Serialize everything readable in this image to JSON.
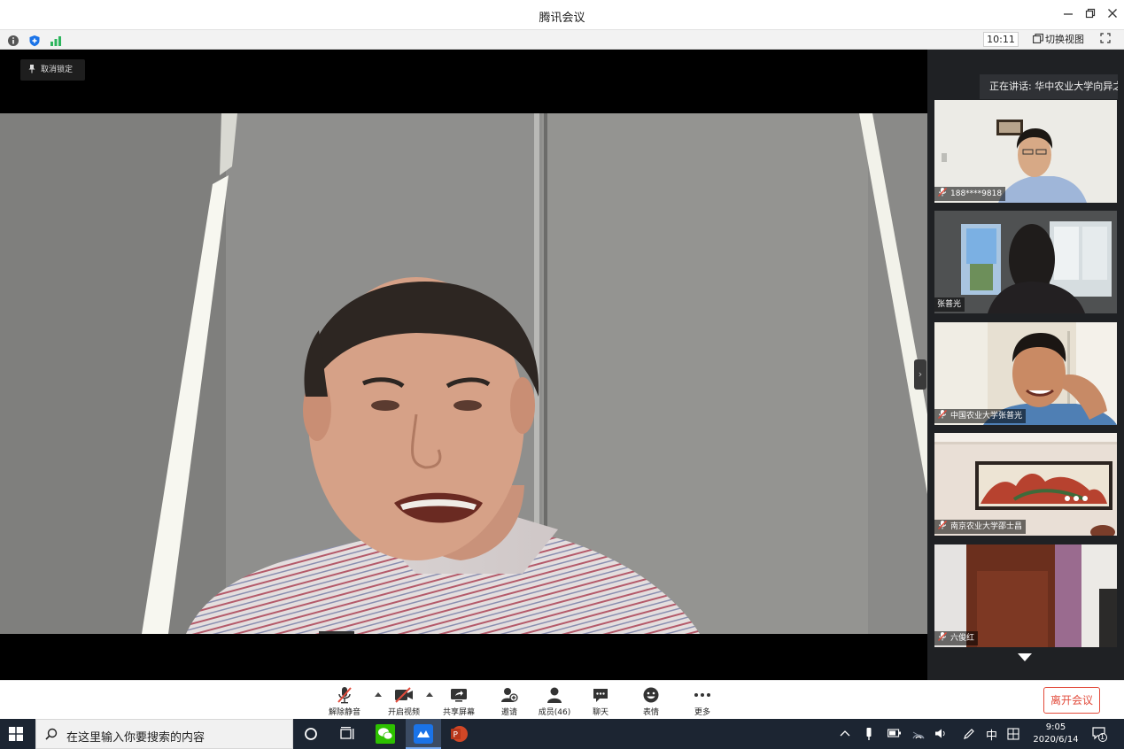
{
  "window": {
    "title": "腾讯会议",
    "clock": "10:11",
    "switch_view": "切换视图"
  },
  "stage": {
    "unlock_label": "取消锁定"
  },
  "sidebar": {
    "speaking": "正在讲话: 华中农业大学向异之;",
    "participants": [
      {
        "name": "188****9818",
        "muted": true
      },
      {
        "name": "张普光",
        "muted": false
      },
      {
        "name": "中国农业大学张普光",
        "muted": true
      },
      {
        "name": "南京农业大学邵士昌",
        "muted": true
      },
      {
        "name": "六俊红",
        "muted": true
      }
    ]
  },
  "controls": {
    "unmute": "解除静音",
    "start_video": "开启视频",
    "share_screen": "共享屏幕",
    "invite": "邀请",
    "members": "成员(46)",
    "chat": "聊天",
    "reactions": "表情",
    "more": "更多",
    "leave": "离开会议"
  },
  "taskbar": {
    "search_placeholder": "在这里输入你要搜索的内容",
    "ime_lang": "中",
    "time": "9:05",
    "date": "2020/6/14",
    "notifications": "1"
  },
  "colors": {
    "accent_blue": "#1a73e8",
    "leave_red": "#e24b3b",
    "signal_green": "#2db55d"
  }
}
